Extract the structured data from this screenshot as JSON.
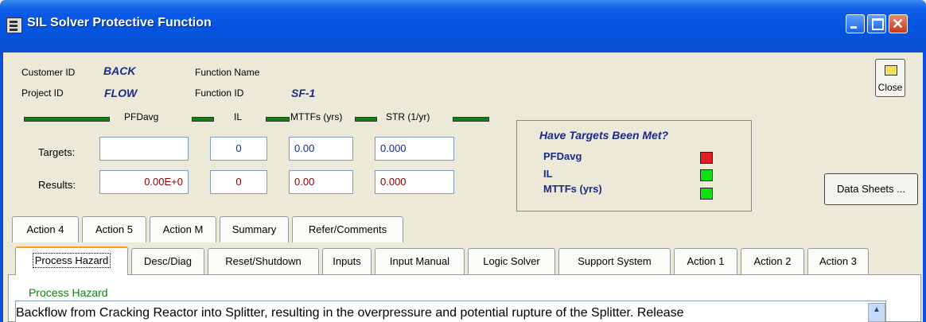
{
  "window": {
    "title": "SIL Solver Protective Function"
  },
  "header": {
    "customer_id_label": "Customer ID",
    "customer_id_value": "BACK",
    "project_id_label": "Project ID",
    "project_id_value": "FLOW",
    "function_name_label": "Function Name",
    "function_name_value": "",
    "function_id_label": "Function ID",
    "function_id_value": "SF-1",
    "close_label": "Close"
  },
  "metrics": {
    "pfdavg_label": "PFDavg",
    "il_label": "IL",
    "mttfs_label": "MTTFs (yrs)",
    "str_label": "STR (1/yr)",
    "targets_label": "Targets:",
    "results_label": "Results:",
    "targets": {
      "pfdavg": "",
      "il": "0",
      "mttfs": "0.00",
      "str": "0.000"
    },
    "results": {
      "pfdavg": "0.00E+0",
      "il": "0",
      "mttfs": "0.00",
      "str": "0.000"
    }
  },
  "targets_met": {
    "title": "Have Targets Been Met?",
    "items": [
      {
        "label": "PFDavg",
        "status": "not-met",
        "color": "#e02020"
      },
      {
        "label": "IL",
        "status": "met",
        "color": "#10e010"
      },
      {
        "label": "MTTFs (yrs)",
        "status": "met",
        "color": "#10e010"
      }
    ]
  },
  "data_sheets_label": "Data Sheets ...",
  "tabs_row1": [
    "Action 4",
    "Action 5",
    "Action M",
    "Summary",
    "Refer/Comments"
  ],
  "tabs_row2": [
    "Process Hazard",
    "Desc/Diag",
    "Reset/Shutdown",
    "Inputs",
    "Input Manual",
    "Logic Solver",
    "Support System",
    "Action 1",
    "Action 2",
    "Action 3"
  ],
  "active_tab": "Process Hazard",
  "panel": {
    "label": "Process Hazard",
    "text": "Backflow from Cracking Reactor into Splitter, resulting in the overpressure and potential rupture of the Splitter.  Release"
  }
}
